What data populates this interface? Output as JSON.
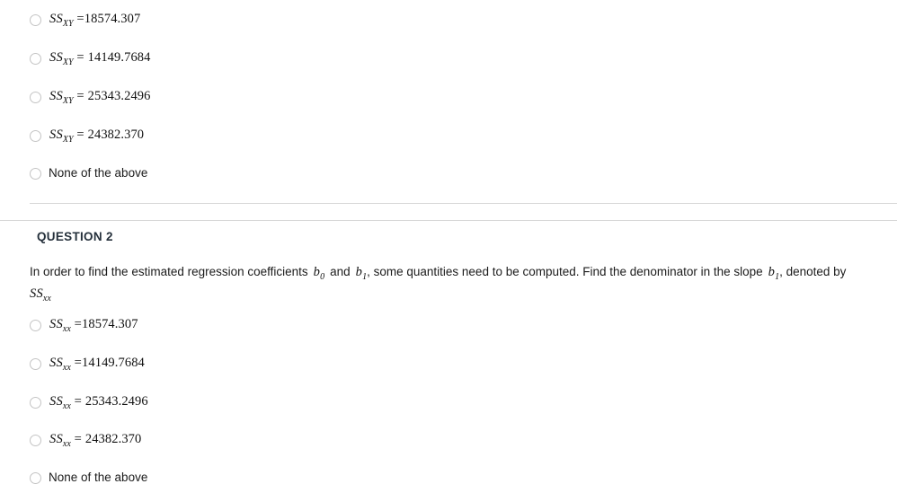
{
  "question_1": {
    "options": [
      {
        "symbol": "SS",
        "subscript": "XY",
        "equals": "=",
        "value": "18574.307",
        "kind": "math"
      },
      {
        "symbol": "SS",
        "subscript": "XY",
        "equals": "=",
        "value": "14149.7684",
        "kind": "math"
      },
      {
        "symbol": "SS",
        "subscript": "XY",
        "equals": "=",
        "value": "25343.2496",
        "kind": "math"
      },
      {
        "symbol": "SS",
        "subscript": "XY",
        "equals": "=",
        "value": "24382.370",
        "kind": "math"
      },
      {
        "label": "None of the above",
        "kind": "plain"
      }
    ]
  },
  "question_2": {
    "heading": "QUESTION 2",
    "body": {
      "part_1": "In order to find the estimated regression coefficients",
      "coefficient_0_symbol": "b",
      "coefficient_0_subscript": "0",
      "part_2": "and",
      "coefficient_1_symbol": "b",
      "coefficient_1_subscript": "1",
      "part_3": ", some quantities need to be computed. Find the denominator in the slope",
      "slope_symbol": "b",
      "slope_subscript": "1",
      "part_4": ", denoted by",
      "denominator_symbol": "SS",
      "denominator_subscript": "xx"
    },
    "options": [
      {
        "symbol": "SS",
        "subscript": "xx",
        "equals": "=",
        "value": "18574.307",
        "kind": "math"
      },
      {
        "symbol": "SS",
        "subscript": "xx",
        "equals": "=",
        "value": "14149.7684",
        "kind": "math"
      },
      {
        "symbol": "SS",
        "subscript": "xx",
        "equals": "=",
        "value": "25343.2496",
        "kind": "math"
      },
      {
        "symbol": "SS",
        "subscript": "xx",
        "equals": "=",
        "value": "24382.370",
        "kind": "math"
      },
      {
        "label": "None of the above",
        "kind": "plain"
      }
    ]
  },
  "colors": {
    "page_background": "#ffffff",
    "text": "#1b1b1b",
    "heading": "#25303b",
    "divider": "#d6d6d6",
    "radio_border": "#c4c4c4"
  }
}
